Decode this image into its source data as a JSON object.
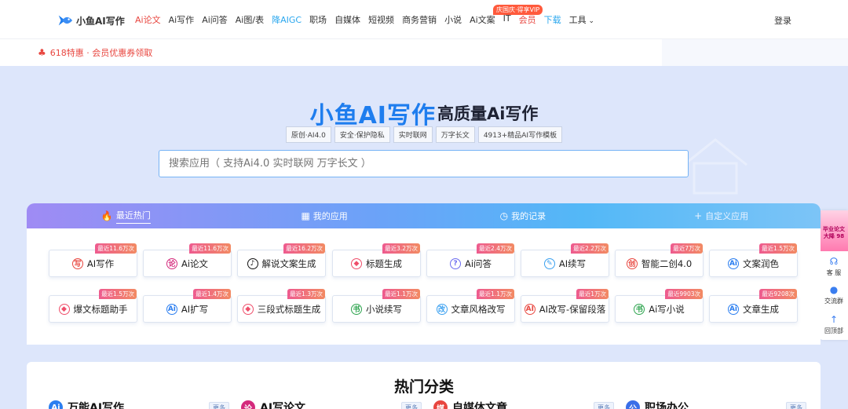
{
  "brand": {
    "name": "小鱼AI写作"
  },
  "nav": {
    "links": [
      {
        "label": "Ai论文",
        "style": "red"
      },
      {
        "label": "Ai写作",
        "style": ""
      },
      {
        "label": "Ai问答",
        "style": ""
      },
      {
        "label": "Ai图/表",
        "style": ""
      },
      {
        "label": "降AIGC",
        "style": "blue"
      },
      {
        "label": "职场",
        "style": ""
      },
      {
        "label": "自媒体",
        "style": ""
      },
      {
        "label": "短视频",
        "style": ""
      },
      {
        "label": "商务营销",
        "style": ""
      },
      {
        "label": "小说",
        "style": ""
      },
      {
        "label": "Ai文案",
        "style": ""
      },
      {
        "label": "IT",
        "style": ""
      },
      {
        "label": "会员",
        "style": "red"
      },
      {
        "label": "下载",
        "style": "blue"
      },
      {
        "label": "工具",
        "style": "tool"
      }
    ],
    "vip_badge": "庆国庆·得享VIP",
    "login": "登录"
  },
  "promo": {
    "text": "618特惠 · 会员优惠券领取"
  },
  "hero": {
    "title": "小鱼AI写作",
    "subtitle": "高质量Ai写作",
    "tags": [
      "原创·AI4.0",
      "安全·保护隐私",
      "实时联网",
      "万字长文",
      "4913+精品AI写作模板"
    ],
    "search_placeholder": "搜索应用（ 支持Ai4.0 实时联网 万字长文 ）"
  },
  "side": {
    "banner": "毕业论文 大降 98",
    "service": "客 服",
    "group": "交流群",
    "top": "回顶部"
  },
  "tabs": [
    {
      "label": "最近热门",
      "icon": "fire-icon",
      "active": true
    },
    {
      "label": "我的应用",
      "icon": "grid-icon",
      "active": false
    },
    {
      "label": "我的记录",
      "icon": "clock-icon",
      "active": false
    },
    {
      "label": "自定义应用",
      "icon": "plus-icon",
      "active": false
    }
  ],
  "apps": [
    {
      "label": "AI写作",
      "badge": "最近11.6万次",
      "icon": "写",
      "color": "#e8463f"
    },
    {
      "label": "Ai论文",
      "badge": "最近11.6万次",
      "icon": "论",
      "color": "#d42a7c"
    },
    {
      "label": "解说文案生成",
      "badge": "最近16.2万次",
      "icon": "♪",
      "color": "#111111"
    },
    {
      "label": "标题生成",
      "badge": "最近3.2万次",
      "icon": "◆",
      "color": "#ef4e6a"
    },
    {
      "label": "Ai问答",
      "badge": "最近2.4万次",
      "icon": "?",
      "color": "#6c6cf0"
    },
    {
      "label": "AI续写",
      "badge": "最近2.2万次",
      "icon": "✎",
      "color": "#3aa0f0"
    },
    {
      "label": "智能二创4.0",
      "badge": "最近7万次",
      "icon": "创",
      "color": "#e8463f"
    },
    {
      "label": "文案润色",
      "badge": "最近1.5万次",
      "icon": "Ai",
      "color": "#2b7ef0"
    },
    {
      "label": "爆文标题助手",
      "badge": "最近1.5万次",
      "icon": "◆",
      "color": "#ef4e6a"
    },
    {
      "label": "AI扩写",
      "badge": "最近1.4万次",
      "icon": "Ai",
      "color": "#2b7ef0"
    },
    {
      "label": "三段式标题生成",
      "badge": "最近1.3万次",
      "icon": "◆",
      "color": "#ef4e6a"
    },
    {
      "label": "小说续写",
      "badge": "最近1.1万次",
      "icon": "书",
      "color": "#2da44e"
    },
    {
      "label": "文章风格改写",
      "badge": "最近1.1万次",
      "icon": "改",
      "color": "#3aa0f0"
    },
    {
      "label": "AI改写-保留段落",
      "badge": "最近1万次",
      "icon": "AI",
      "color": "#e8463f"
    },
    {
      "label": "Ai写小说",
      "badge": "最近9903次",
      "icon": "书",
      "color": "#2da44e"
    },
    {
      "label": "文章生成",
      "badge": "最近9208次",
      "icon": "Ai",
      "color": "#2b7ef0"
    }
  ],
  "hot": {
    "title": "热门分类",
    "more": "更多",
    "categories": [
      {
        "label": "万能AI写作",
        "icon": "Ai",
        "color": "#2b7ef0"
      },
      {
        "label": "AI写论文",
        "icon": "论",
        "color": "#d42a7c"
      },
      {
        "label": "自媒体文章",
        "icon": "媒",
        "color": "#e8463f"
      },
      {
        "label": "职场办公",
        "icon": "公",
        "color": "#3a6ee8"
      }
    ]
  }
}
